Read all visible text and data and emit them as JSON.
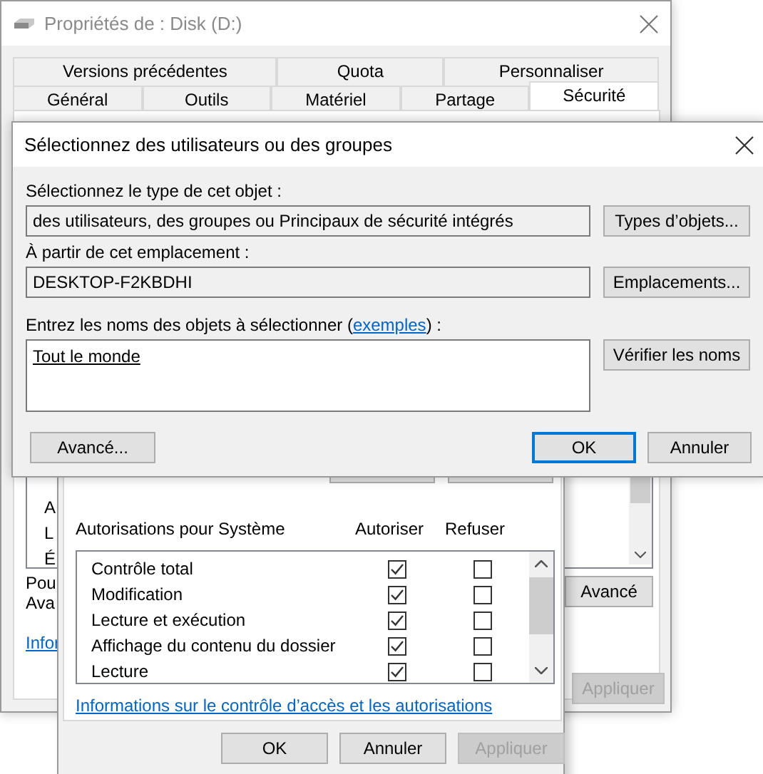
{
  "properties_window": {
    "title": "Propriétés de : Disk (D:)",
    "tabs_row1": [
      {
        "label": "Versions précédentes",
        "selected": false
      },
      {
        "label": "Quota",
        "selected": false
      },
      {
        "label": "Personnaliser",
        "selected": false
      }
    ],
    "tabs_row2": [
      {
        "label": "Général",
        "selected": false
      },
      {
        "label": "Outils",
        "selected": false
      },
      {
        "label": "Matériel",
        "selected": false
      },
      {
        "label": "Partage",
        "selected": false
      },
      {
        "label": "Sécurité",
        "selected": true
      }
    ],
    "list_items": [
      "A",
      "L",
      "É"
    ],
    "text_lines": [
      "Pou",
      "Ava"
    ],
    "advanced_button": "Avancé",
    "link": "Infor",
    "apply_button": {
      "label": "Appliquer",
      "disabled": true
    }
  },
  "permissions_window": {
    "permissions_label": "Autorisations pour Système",
    "columns": [
      "Autoriser",
      "Refuser"
    ],
    "permissions": [
      {
        "name": "Contrôle total",
        "allow": true,
        "deny": false
      },
      {
        "name": "Modification",
        "allow": true,
        "deny": false
      },
      {
        "name": "Lecture et exécution",
        "allow": true,
        "deny": false
      },
      {
        "name": "Affichage du contenu du dossier",
        "allow": true,
        "deny": false
      },
      {
        "name": "Lecture",
        "allow": true,
        "deny": false
      }
    ],
    "link": "Informations sur le contrôle d’accès et les autorisations",
    "buttons": [
      {
        "label": "OK",
        "disabled": false
      },
      {
        "label": "Annuler",
        "disabled": false
      },
      {
        "label": "Appliquer",
        "disabled": true
      }
    ]
  },
  "select_dialog": {
    "title": "Sélectionnez des utilisateurs ou des groupes",
    "object_type_label": "Sélectionnez le type de cet objet :",
    "object_type_value": "des utilisateurs, des groupes ou Principaux de sécurité intégrés",
    "object_type_button": "Types d’objets...",
    "location_label": "À partir de cet emplacement :",
    "location_value": "DESKTOP-F2KBDHI",
    "location_button": "Emplacements...",
    "names_label": "Entrez les noms des objets à sélectionner (",
    "names_link": "exemples",
    "names_label_end": ") :",
    "names_value": "Tout le monde",
    "check_button": "Vérifier les noms",
    "advanced_button": "Avancé...",
    "buttons": [
      {
        "label": "OK",
        "default": true
      },
      {
        "label": "Annuler",
        "default": false
      }
    ]
  }
}
